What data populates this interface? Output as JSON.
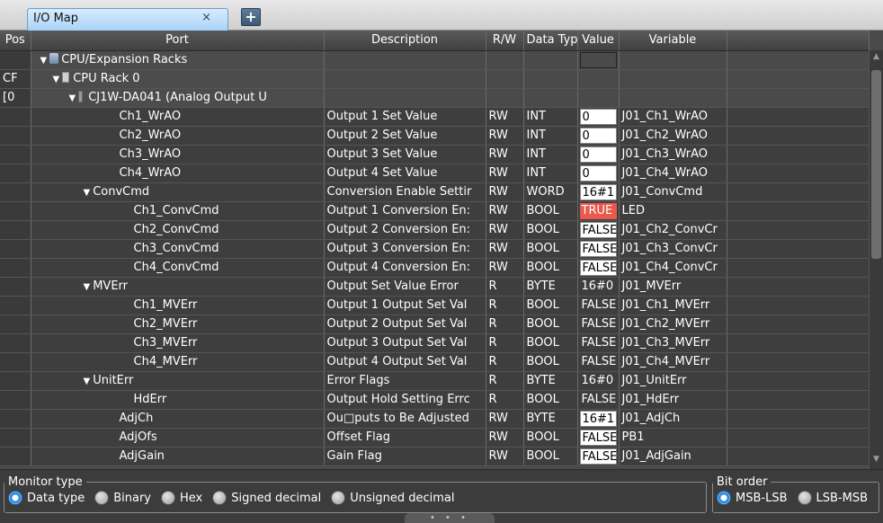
{
  "tab": {
    "title": "I/O Map",
    "close": "×",
    "add": "+"
  },
  "columns": {
    "pos": "Pos",
    "port": "Port",
    "description": "Description",
    "rw": "R/W",
    "data_type": "Data Typ",
    "value": "Value",
    "variable": "Variable"
  },
  "tree": {
    "cpu_racks": "CPU/Expansion Racks",
    "cpu_rack0_pos": "CF",
    "cpu_rack0": "CPU Rack 0",
    "unit_pos": "[0",
    "unit": "CJ1W-DA041 (Analog Output U"
  },
  "rows": [
    {
      "port": "Ch1_WrAO",
      "desc": "Output 1 Set Value",
      "rw": "RW",
      "type": "INT",
      "value": "0",
      "vstyle": "white",
      "var": "J01_Ch1_WrAO",
      "indent": 3
    },
    {
      "port": "Ch2_WrAO",
      "desc": "Output 2 Set Value",
      "rw": "RW",
      "type": "INT",
      "value": "0",
      "vstyle": "white",
      "var": "J01_Ch2_WrAO",
      "indent": 3
    },
    {
      "port": "Ch3_WrAO",
      "desc": "Output 3 Set Value",
      "rw": "RW",
      "type": "INT",
      "value": "0",
      "vstyle": "white",
      "var": "J01_Ch3_WrAO",
      "indent": 3
    },
    {
      "port": "Ch4_WrAO",
      "desc": "Output 4 Set Value",
      "rw": "RW",
      "type": "INT",
      "value": "0",
      "vstyle": "white",
      "var": "J01_Ch4_WrAO",
      "indent": 3
    },
    {
      "port": "ConvCmd",
      "desc": "Conversion Enable Settir",
      "rw": "RW",
      "type": "WORD",
      "value": "16#1",
      "vstyle": "white",
      "var": "J01_ConvCmd",
      "indent": 2,
      "caret": true
    },
    {
      "port": "Ch1_ConvCmd",
      "desc": "Output 1 Conversion En:",
      "rw": "RW",
      "type": "BOOL",
      "value": "TRUE",
      "vstyle": "red",
      "var": "LED",
      "indent": 4
    },
    {
      "port": "Ch2_ConvCmd",
      "desc": "Output 2 Conversion En:",
      "rw": "RW",
      "type": "BOOL",
      "value": "FALSE",
      "vstyle": "white",
      "var": "J01_Ch2_ConvCr",
      "indent": 4
    },
    {
      "port": "Ch3_ConvCmd",
      "desc": "Output 3 Conversion En:",
      "rw": "RW",
      "type": "BOOL",
      "value": "FALSE",
      "vstyle": "white",
      "var": "J01_Ch3_ConvCr",
      "indent": 4
    },
    {
      "port": "Ch4_ConvCmd",
      "desc": "Output 4 Conversion En:",
      "rw": "RW",
      "type": "BOOL",
      "value": "FALSE",
      "vstyle": "white",
      "var": "J01_Ch4_ConvCr",
      "indent": 4
    },
    {
      "port": "MVErr",
      "desc": "Output Set Value Error",
      "rw": "R",
      "type": "BYTE",
      "value": "16#0",
      "vstyle": "plain",
      "var": "J01_MVErr",
      "indent": 2,
      "caret": true
    },
    {
      "port": "Ch1_MVErr",
      "desc": "Output 1 Output Set Val",
      "rw": "R",
      "type": "BOOL",
      "value": "FALSE",
      "vstyle": "plain",
      "var": "J01_Ch1_MVErr",
      "indent": 4
    },
    {
      "port": "Ch2_MVErr",
      "desc": "Output 2 Output Set Val",
      "rw": "R",
      "type": "BOOL",
      "value": "FALSE",
      "vstyle": "plain",
      "var": "J01_Ch2_MVErr",
      "indent": 4
    },
    {
      "port": "Ch3_MVErr",
      "desc": "Output 3 Output Set Val",
      "rw": "R",
      "type": "BOOL",
      "value": "FALSE",
      "vstyle": "plain",
      "var": "J01_Ch3_MVErr",
      "indent": 4
    },
    {
      "port": "Ch4_MVErr",
      "desc": "Output 4 Output Set Val",
      "rw": "R",
      "type": "BOOL",
      "value": "FALSE",
      "vstyle": "plain",
      "var": "J01_Ch4_MVErr",
      "indent": 4
    },
    {
      "port": "UnitErr",
      "desc": "Error Flags",
      "rw": "R",
      "type": "BYTE",
      "value": "16#0",
      "vstyle": "plain",
      "var": "J01_UnitErr",
      "indent": 2,
      "caret": true
    },
    {
      "port": "HdErr",
      "desc": "Output Hold Setting Errc",
      "rw": "R",
      "type": "BOOL",
      "value": "FALSE",
      "vstyle": "plain",
      "var": "J01_HdErr",
      "indent": 4
    },
    {
      "port": "AdjCh",
      "desc": "Ou□puts to Be Adjusted",
      "rw": "RW",
      "type": "BYTE",
      "value": "16#1",
      "vstyle": "white",
      "var": "J01_AdjCh",
      "indent": 3
    },
    {
      "port": "AdjOfs",
      "desc": "Offset Flag",
      "rw": "RW",
      "type": "BOOL",
      "value": "FALSE",
      "vstyle": "white",
      "var": "PB1",
      "indent": 3
    },
    {
      "port": "AdjGain",
      "desc": "Gain Flag",
      "rw": "RW",
      "type": "BOOL",
      "value": "FALSE",
      "vstyle": "white",
      "var": "J01_AdjGain",
      "indent": 3
    }
  ],
  "monitor": {
    "legend": "Monitor type",
    "options": [
      "Data type",
      "Binary",
      "Hex",
      "Signed decimal",
      "Unsigned decimal"
    ],
    "selected": 0
  },
  "bitorder": {
    "legend": "Bit order",
    "options": [
      "MSB-LSB",
      "LSB-MSB"
    ],
    "selected": 0
  },
  "grip": "• • •",
  "colors": {
    "true_bg": "#e9574d",
    "value_bg": "#ffffff",
    "accent": "#2f8be0"
  }
}
